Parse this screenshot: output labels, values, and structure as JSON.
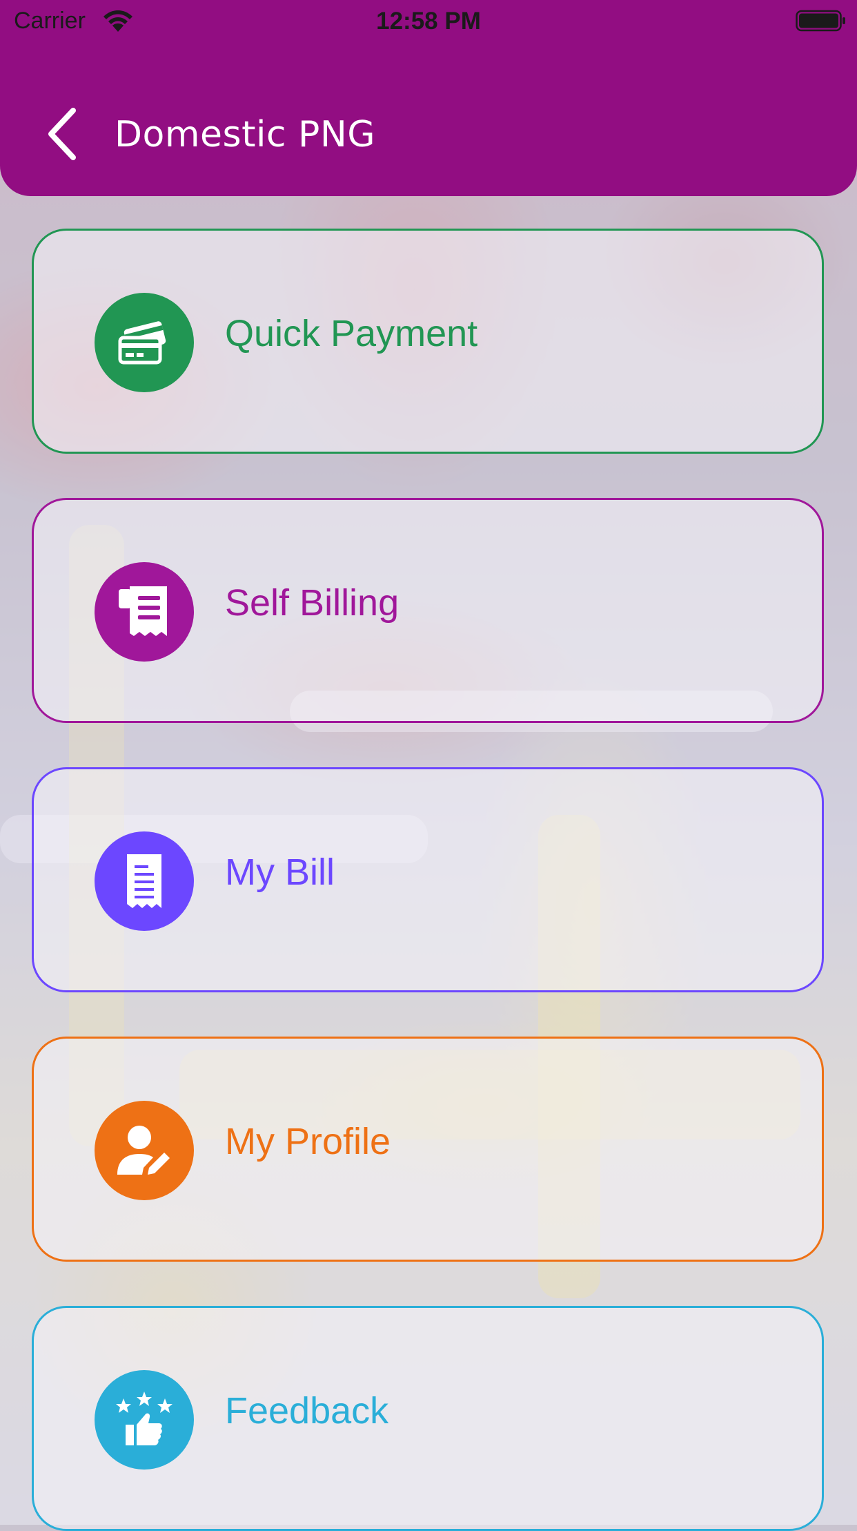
{
  "status_bar": {
    "carrier": "Carrier",
    "time": "12:58 PM",
    "wifi_icon": "wifi-icon",
    "battery_icon": "battery-icon"
  },
  "header": {
    "title": "Domestic PNG",
    "back_icon": "chevron-left-icon",
    "background_color": "#920d82"
  },
  "menu": {
    "items": [
      {
        "label": "Quick Payment",
        "icon": "credit-cards-icon",
        "color": "#219653"
      },
      {
        "label": "Self Billing",
        "icon": "receipt-icon",
        "color": "#a0179a"
      },
      {
        "label": "My Bill",
        "icon": "bill-document-icon",
        "color": "#6c47ff"
      },
      {
        "label": "My Profile",
        "icon": "user-edit-icon",
        "color": "#ee7115"
      },
      {
        "label": "Feedback",
        "icon": "thumbs-up-stars-icon",
        "color": "#2aaed8"
      }
    ]
  }
}
